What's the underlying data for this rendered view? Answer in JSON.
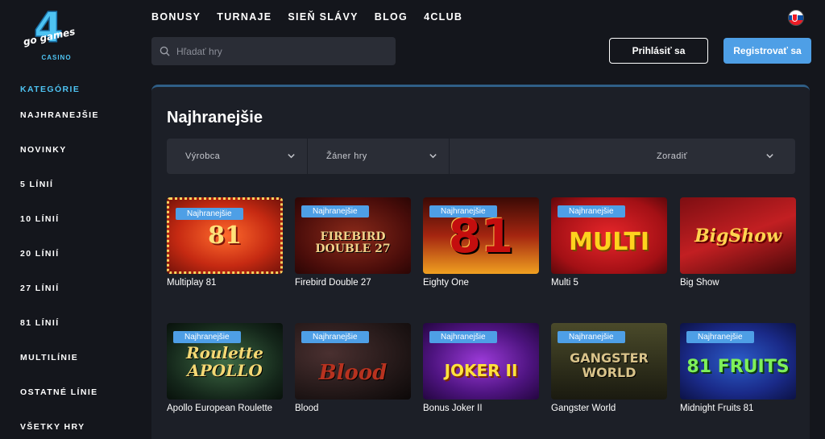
{
  "brand": {
    "logo_number": "4",
    "logo_text": "go games",
    "logo_sub": "CASINO"
  },
  "nav": {
    "items": [
      "BONUSY",
      "TURNAJE",
      "SIEŇ SLÁVY",
      "BLOG",
      "4CLUB"
    ]
  },
  "search": {
    "placeholder": "Hľadať hry"
  },
  "auth": {
    "login_label": "Prihlásiť sa",
    "register_label": "Registrovať sa"
  },
  "sidebar": {
    "heading": "KATEGÓRIE",
    "items": [
      "NAJHRANEJŠIE",
      "NOVINKY",
      "5 LÍNIÍ",
      "10 LÍNIÍ",
      "20 LÍNIÍ",
      "27 LÍNIÍ",
      "81 LÍNIÍ",
      "MULTILÍNIE",
      "OSTATNÉ LÍNIE",
      "VŠETKY HRY"
    ]
  },
  "main": {
    "title": "Najhranejšie",
    "filters": {
      "producer": "Výrobca",
      "genre": "Žáner hry",
      "sort": "Zoradiť"
    },
    "badge_label": "Najhranejšie",
    "games": [
      {
        "name": "Multiplay 81",
        "art": "81"
      },
      {
        "name": "Firebird Double 27",
        "art": "FIREBIRD DOUBLE 27"
      },
      {
        "name": "Eighty One",
        "art": "81"
      },
      {
        "name": "Multi 5",
        "art": "MULTI"
      },
      {
        "name": "Big Show",
        "art": "BigShow"
      },
      {
        "name": "Apollo European Roulette",
        "art": "Roulette APOLLO"
      },
      {
        "name": "Blood",
        "art": "Blood"
      },
      {
        "name": "Bonus Joker II",
        "art": "JOKER II"
      },
      {
        "name": "Gangster World",
        "art": "GANGSTER WORLD"
      },
      {
        "name": "Midnight Fruits 81",
        "art": "81 FRUITS"
      }
    ]
  },
  "colors": {
    "accent": "#4e9fe6",
    "accent_light": "#4ec3f2",
    "bg": "#14161c",
    "panel": "#1c1f27",
    "control": "#2a2d36"
  },
  "icons": {
    "search": "search-icon",
    "chevron": "chevron-down-icon",
    "flag": "slovak-flag-icon"
  }
}
